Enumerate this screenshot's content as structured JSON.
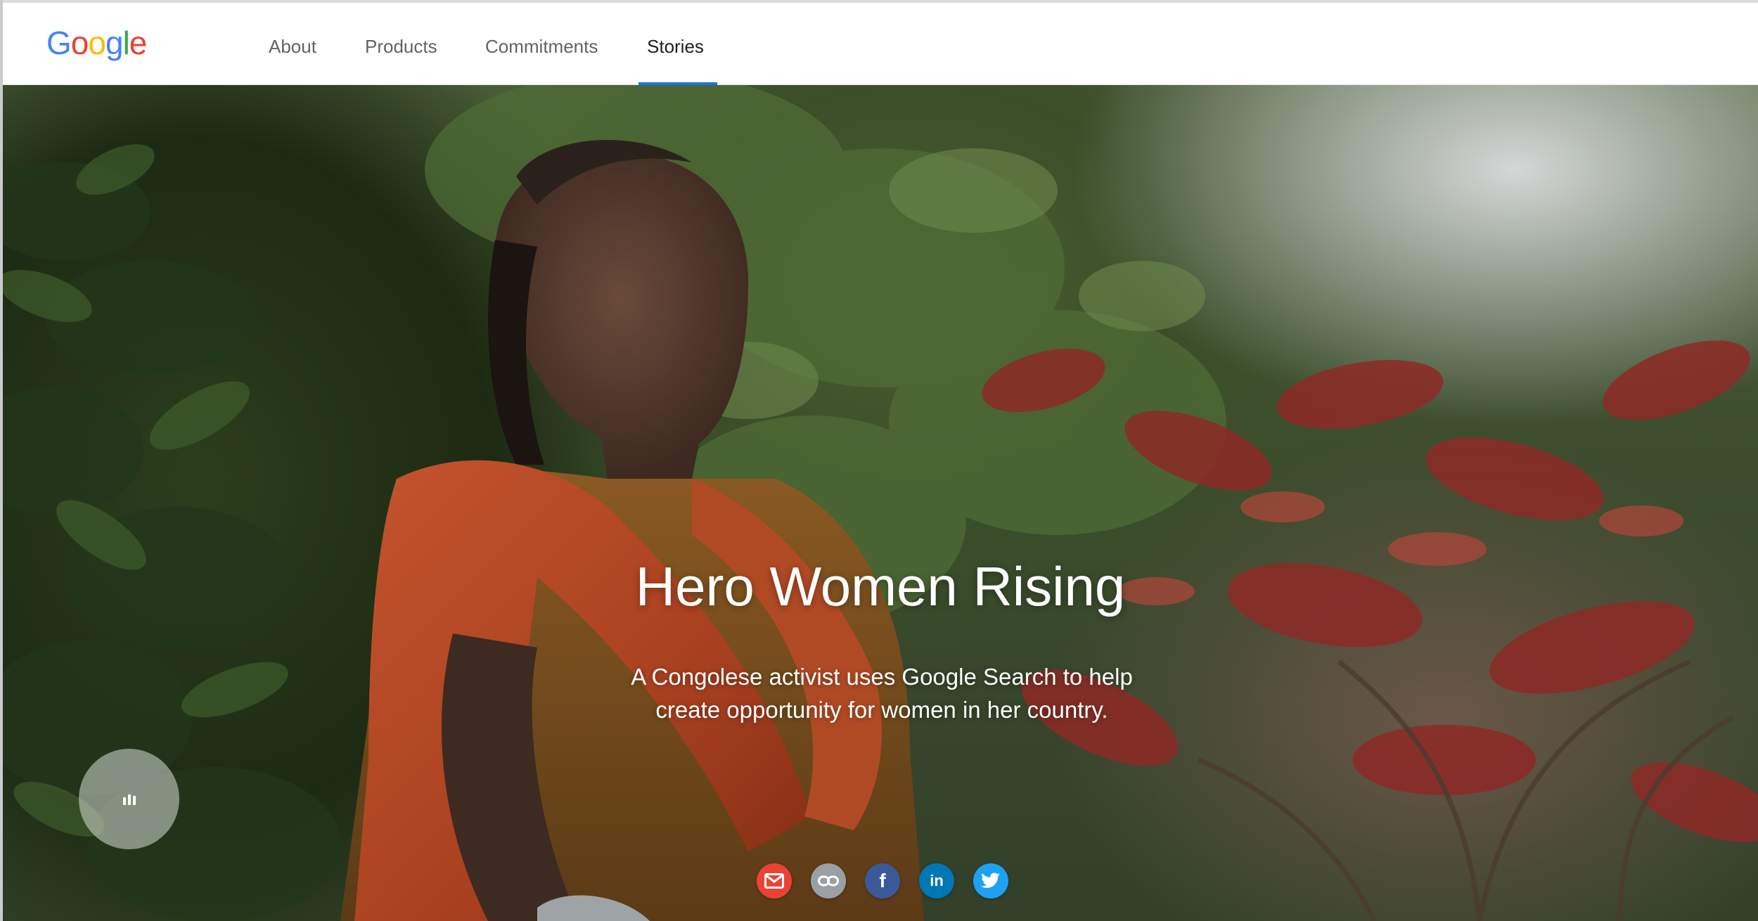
{
  "brand": {
    "logo_letters": [
      {
        "char": "G",
        "color": "#4285F4"
      },
      {
        "char": "o",
        "color": "#EA4335"
      },
      {
        "char": "o",
        "color": "#FBBC05"
      },
      {
        "char": "g",
        "color": "#4285F4"
      },
      {
        "char": "l",
        "color": "#34A853"
      },
      {
        "char": "e",
        "color": "#EA4335"
      }
    ]
  },
  "nav": {
    "items": [
      {
        "label": "About"
      },
      {
        "label": "Products"
      },
      {
        "label": "Commitments"
      },
      {
        "label": "Stories",
        "active": true
      }
    ],
    "active_color": "#1a73e8"
  },
  "hero": {
    "title": "Hero Women Rising",
    "subtitle_line1": "A Congolese activist uses Google Search to help",
    "subtitle_line2": "create opportunity for women in her country."
  },
  "share": {
    "buttons": [
      {
        "name": "email",
        "icon": "envelope-icon",
        "color": "#ea4335"
      },
      {
        "name": "link",
        "icon": "link-icon",
        "color": "#9aa0a6"
      },
      {
        "name": "facebook",
        "icon": "facebook-icon",
        "color": "#3b5998",
        "glyph": "f"
      },
      {
        "name": "linkedin",
        "icon": "linkedin-icon",
        "color": "#0077b5",
        "glyph": "in"
      },
      {
        "name": "twitter",
        "icon": "twitter-icon",
        "color": "#1da1f2"
      }
    ]
  },
  "audio": {
    "icon": "audio-bars-icon"
  }
}
